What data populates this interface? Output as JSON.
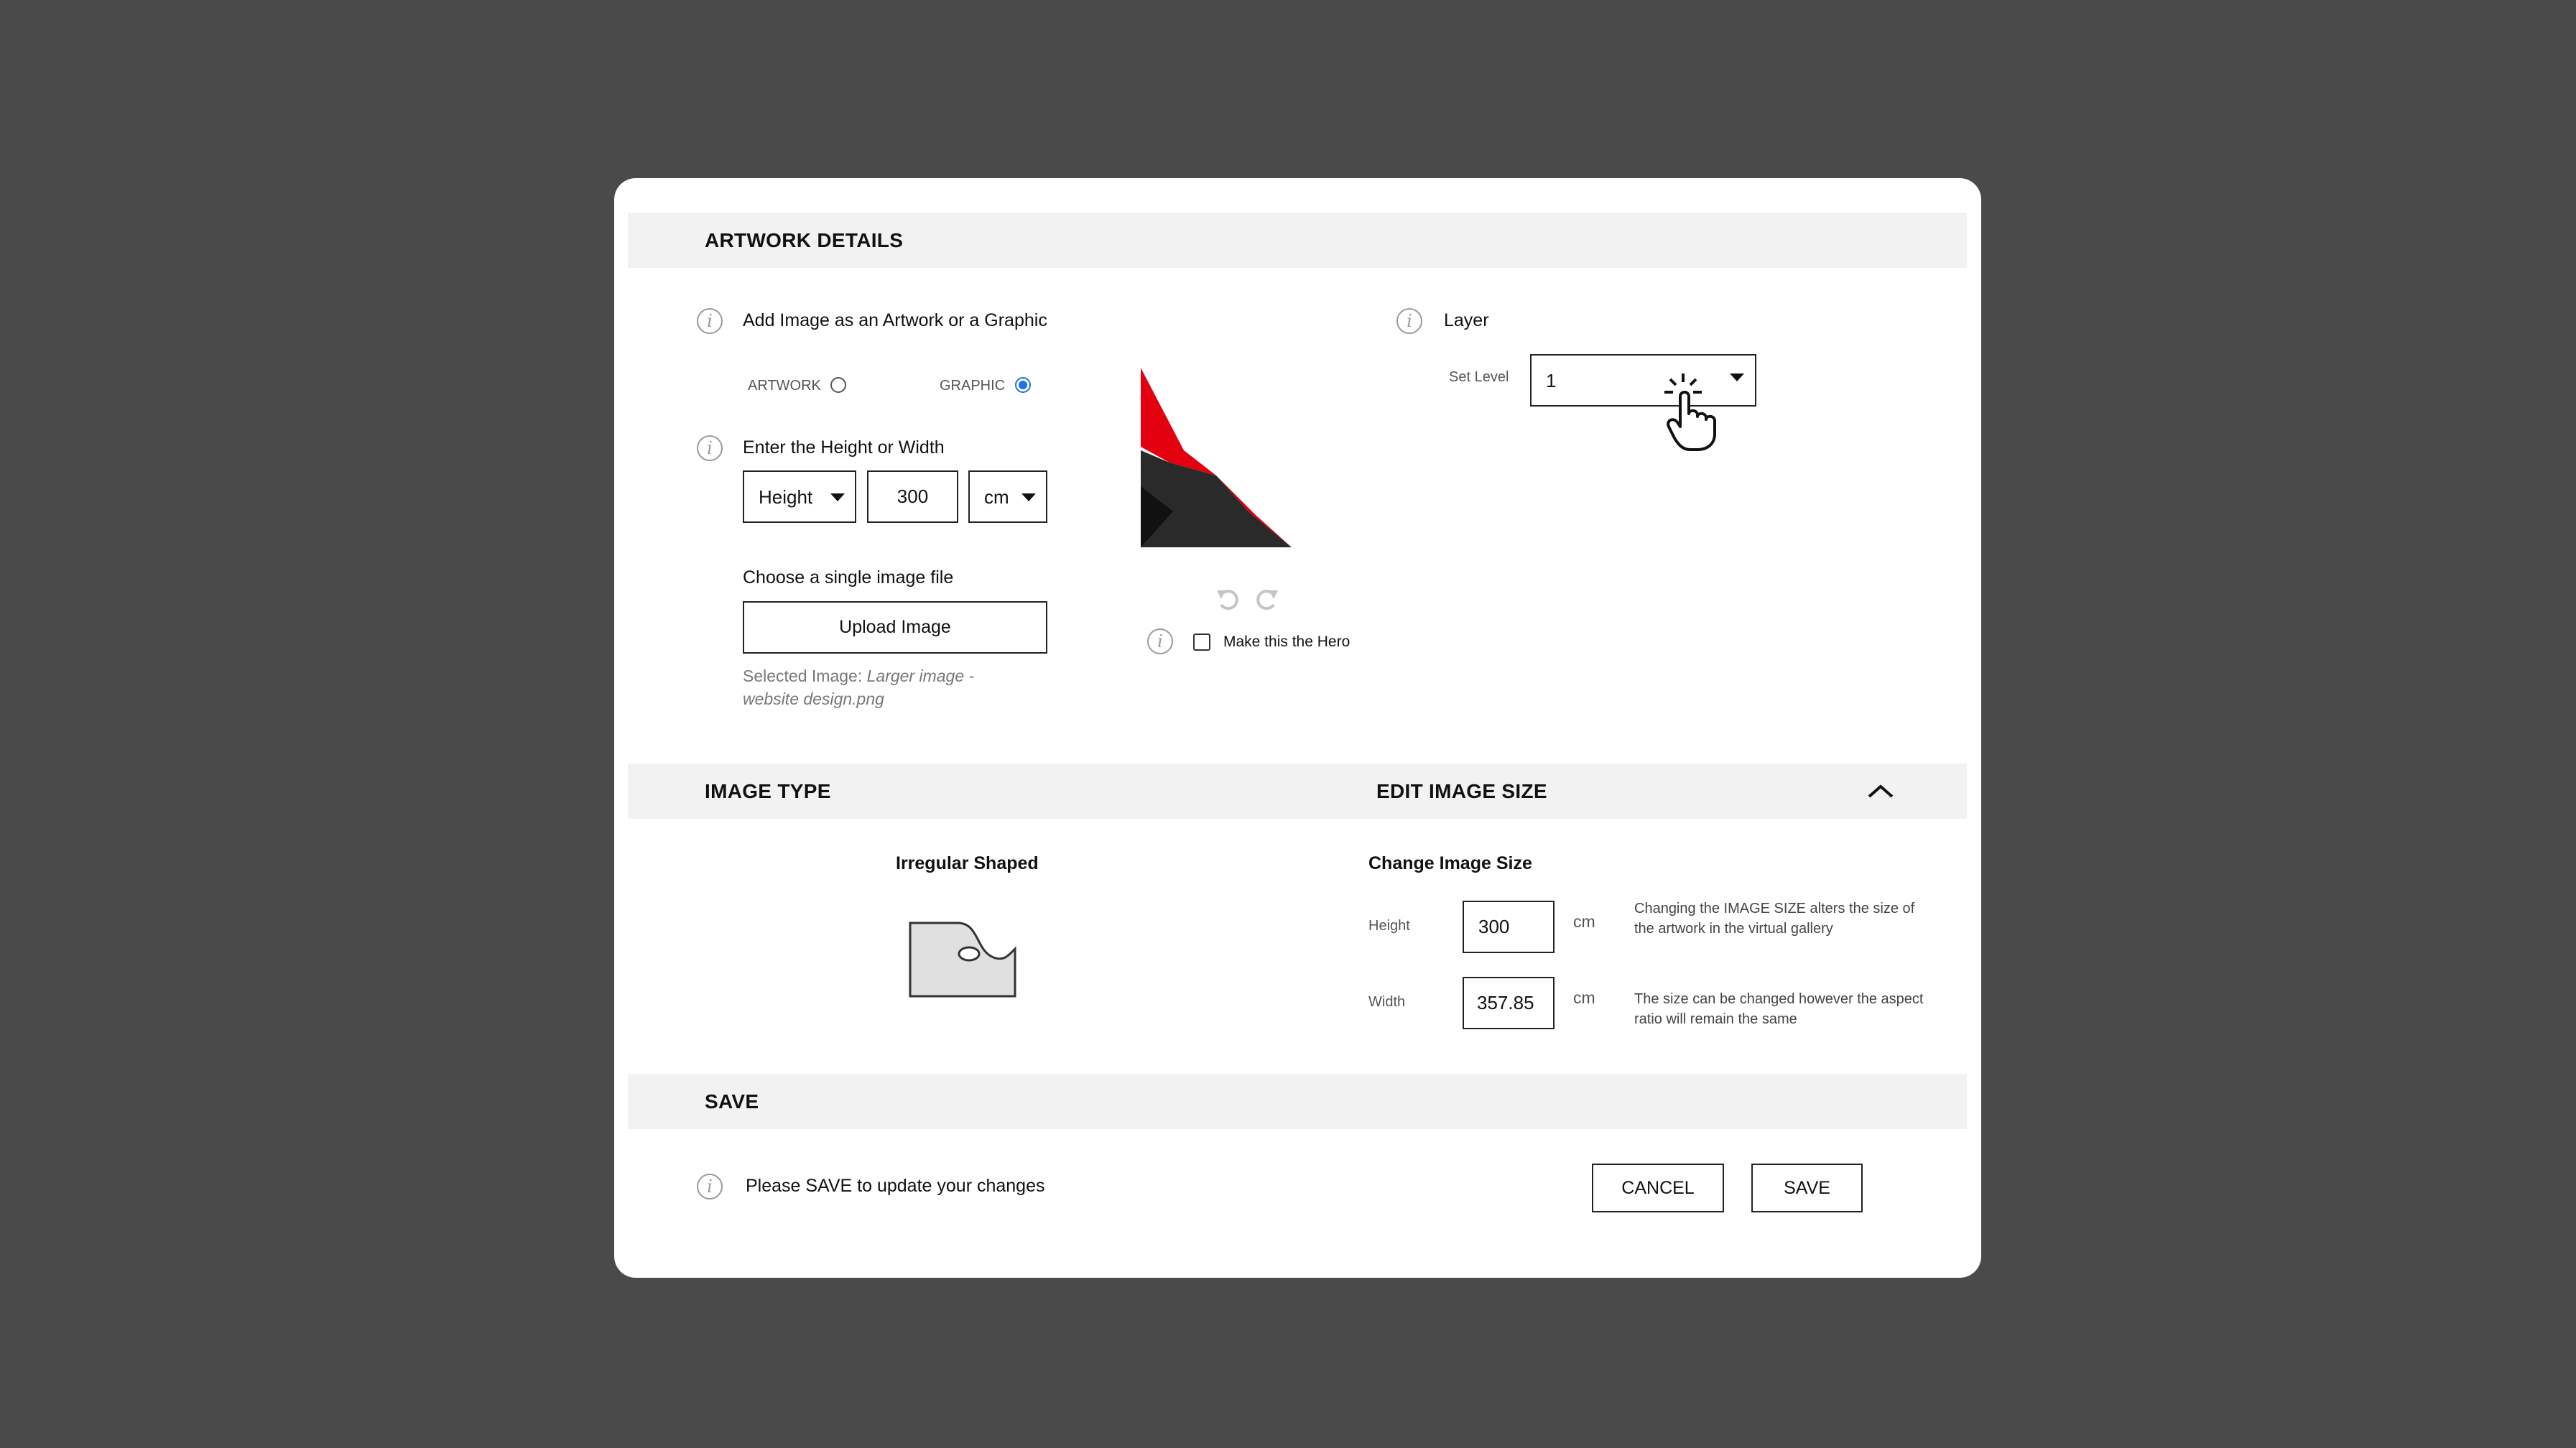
{
  "sections": {
    "artwork_details": "ARTWORK DETAILS",
    "image_type": "IMAGE TYPE",
    "edit_image_size": "EDIT IMAGE SIZE",
    "save": "SAVE"
  },
  "artwork": {
    "add_image_label": "Add Image as an Artwork or a Graphic",
    "option_artwork": "ARTWORK",
    "option_graphic": "GRAPHIC",
    "selected_option": "GRAPHIC",
    "dimension_label": "Enter the Height or Width",
    "dimension_select": "Height",
    "dimension_value": "300",
    "unit_select": "cm",
    "choose_file_label": "Choose a single image file",
    "upload_button": "Upload Image",
    "selected_image_prefix": "Selected Image:",
    "selected_image_name": "Larger image - website design.png",
    "hero_label": "Make this the Hero",
    "hero_checked": false
  },
  "layer": {
    "title": "Layer",
    "set_level_label": "Set Level",
    "set_level_value": "1"
  },
  "image_type": {
    "shape_label": "Irregular Shaped"
  },
  "edit_size": {
    "change_label": "Change Image Size",
    "height_label": "Height",
    "height_value": "300",
    "height_unit": "cm",
    "width_label": "Width",
    "width_value": "357.85",
    "width_unit": "cm",
    "note_height": "Changing the IMAGE SIZE alters the size of the artwork in the virtual gallery",
    "note_width": "The size can be changed however the aspect ratio will remain the same"
  },
  "save": {
    "message": "Please SAVE to update your changes",
    "cancel_button": "CANCEL",
    "save_button": "SAVE"
  },
  "icons": {
    "info": "info-icon",
    "undo": "undo-icon",
    "redo": "redo-icon",
    "chevron_up": "chevron-up-icon",
    "cursor": "hand-pointer-icon"
  },
  "colors": {
    "backdrop": "#4a4a4a",
    "section_bar": "#f2f2f2",
    "radio_selected": "#1a73e8",
    "artwork_red": "#e3000f"
  }
}
